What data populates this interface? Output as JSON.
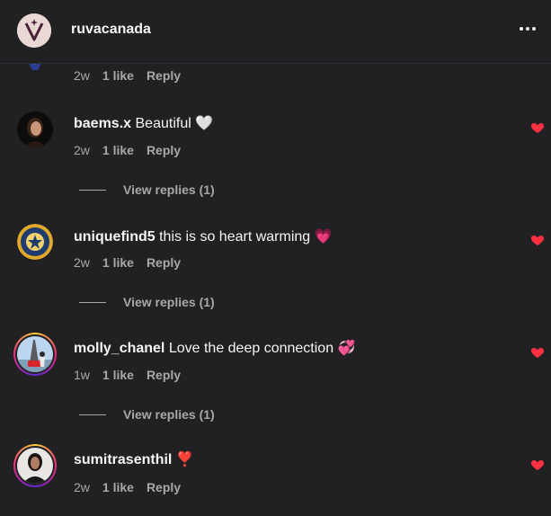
{
  "header": {
    "account_name": "ruvacanada",
    "avatar_letter": "V",
    "more_icon": "more-horizontal-icon"
  },
  "comments": [
    {
      "username": "",
      "text": "",
      "time": "2w",
      "likes": "1 like",
      "reply": "Reply",
      "liked": false
    },
    {
      "username": "baems.x",
      "text": "Beautiful",
      "emoji": "🤍",
      "time": "2w",
      "likes": "1 like",
      "reply": "Reply",
      "view_replies": "View replies (1)",
      "liked": true
    },
    {
      "username": "uniquefind5",
      "text": "this is so heart warming",
      "emoji": "💗",
      "time": "2w",
      "likes": "1 like",
      "reply": "Reply",
      "view_replies": "View replies (1)",
      "liked": true
    },
    {
      "username": "molly_chanel",
      "text": "Love the deep connection",
      "emoji": "💞",
      "time": "1w",
      "likes": "1 like",
      "reply": "Reply",
      "view_replies": "View replies (1)",
      "liked": true
    },
    {
      "username": "sumitrasenthil",
      "text": "",
      "emoji": "❣️",
      "time": "2w",
      "likes": "1 like",
      "reply": "Reply",
      "liked": true
    }
  ],
  "colors": {
    "background": "#212124",
    "text_primary": "#f5f5f5",
    "text_secondary": "#a8a8a8",
    "heart_liked": "#ff3040"
  }
}
